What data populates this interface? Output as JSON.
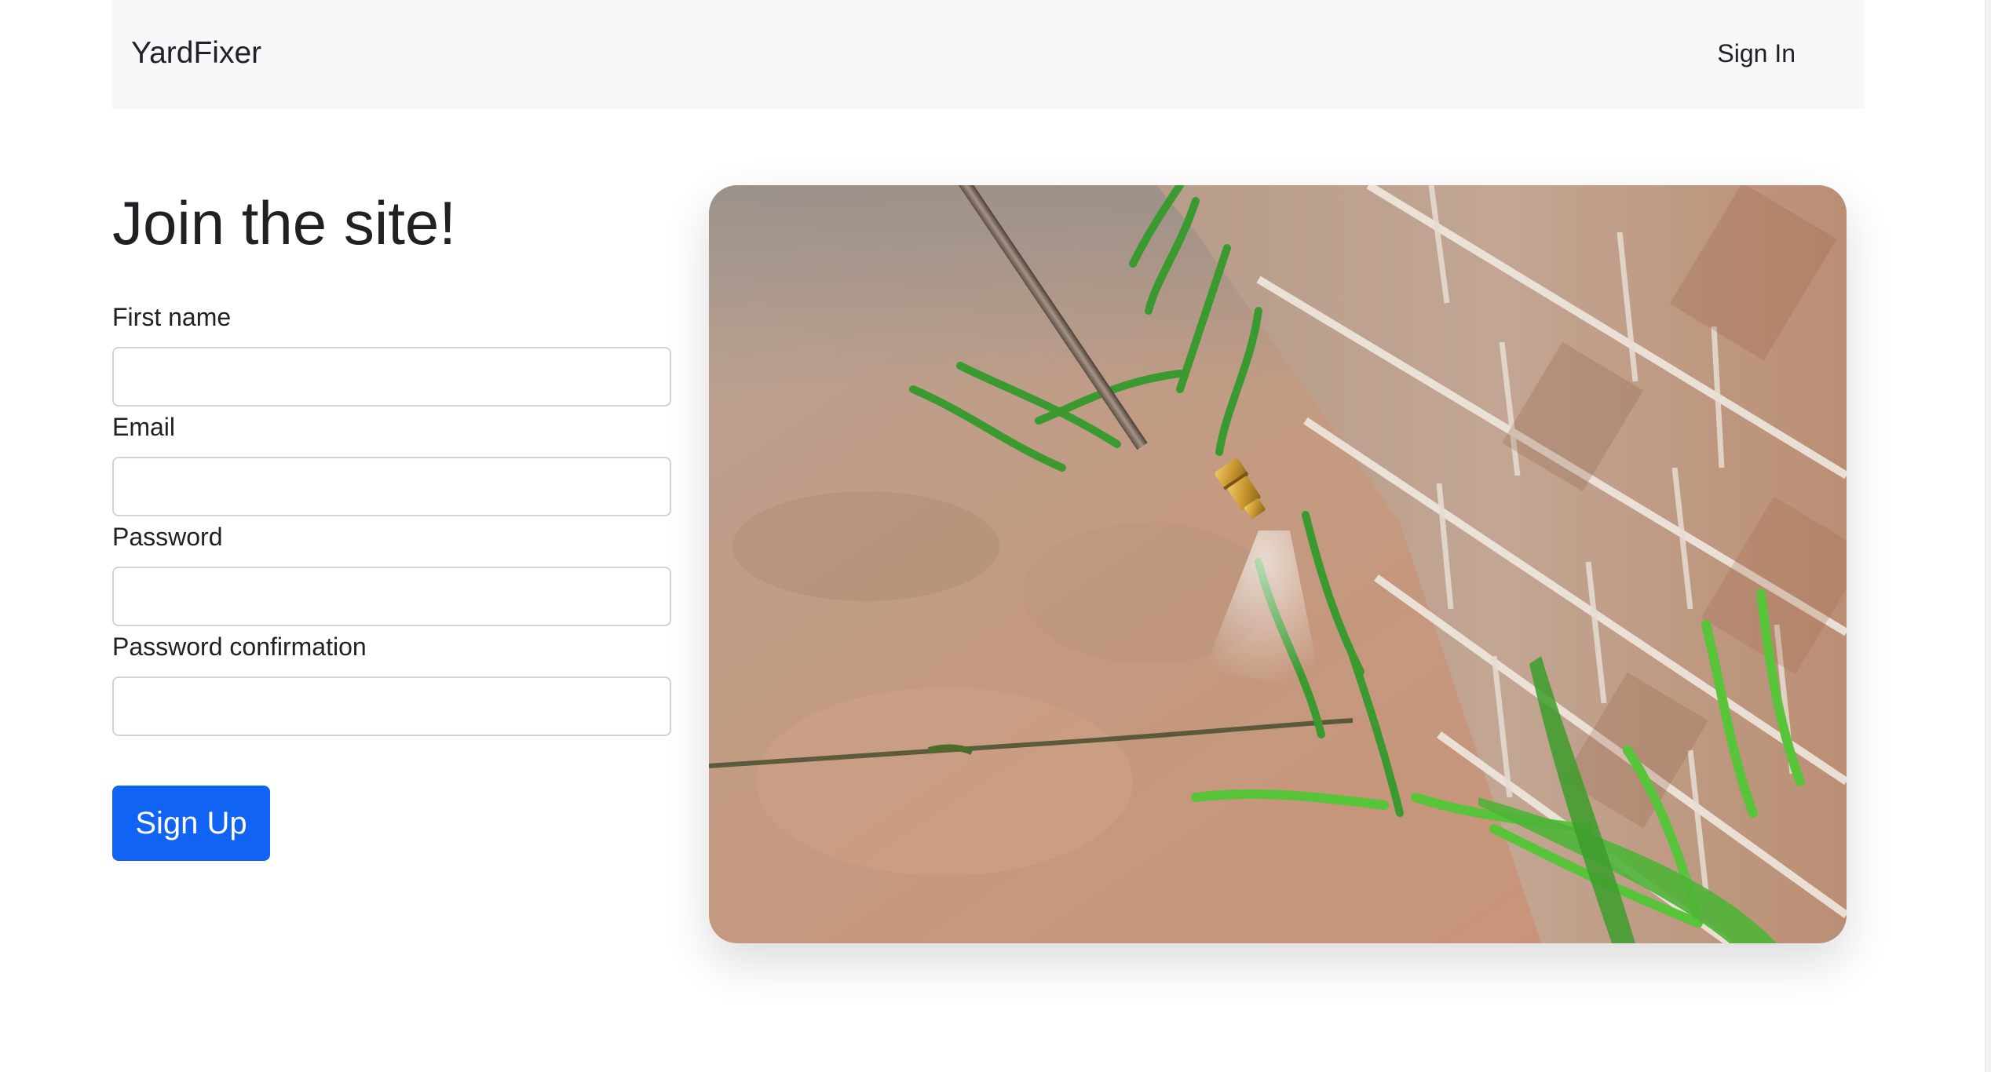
{
  "navbar": {
    "brand": "YardFixer",
    "sign_in": "Sign In"
  },
  "form": {
    "heading": "Join the site!",
    "fields": [
      {
        "label": "First name",
        "value": "",
        "type": "text"
      },
      {
        "label": "Email",
        "value": "",
        "type": "email"
      },
      {
        "label": "Password",
        "value": "",
        "type": "password"
      },
      {
        "label": "Password confirmation",
        "value": "",
        "type": "password"
      }
    ],
    "submit_label": "Sign Up"
  },
  "colors": {
    "accent": "#1164f3",
    "navbar_bg": "#f7f8f9"
  }
}
